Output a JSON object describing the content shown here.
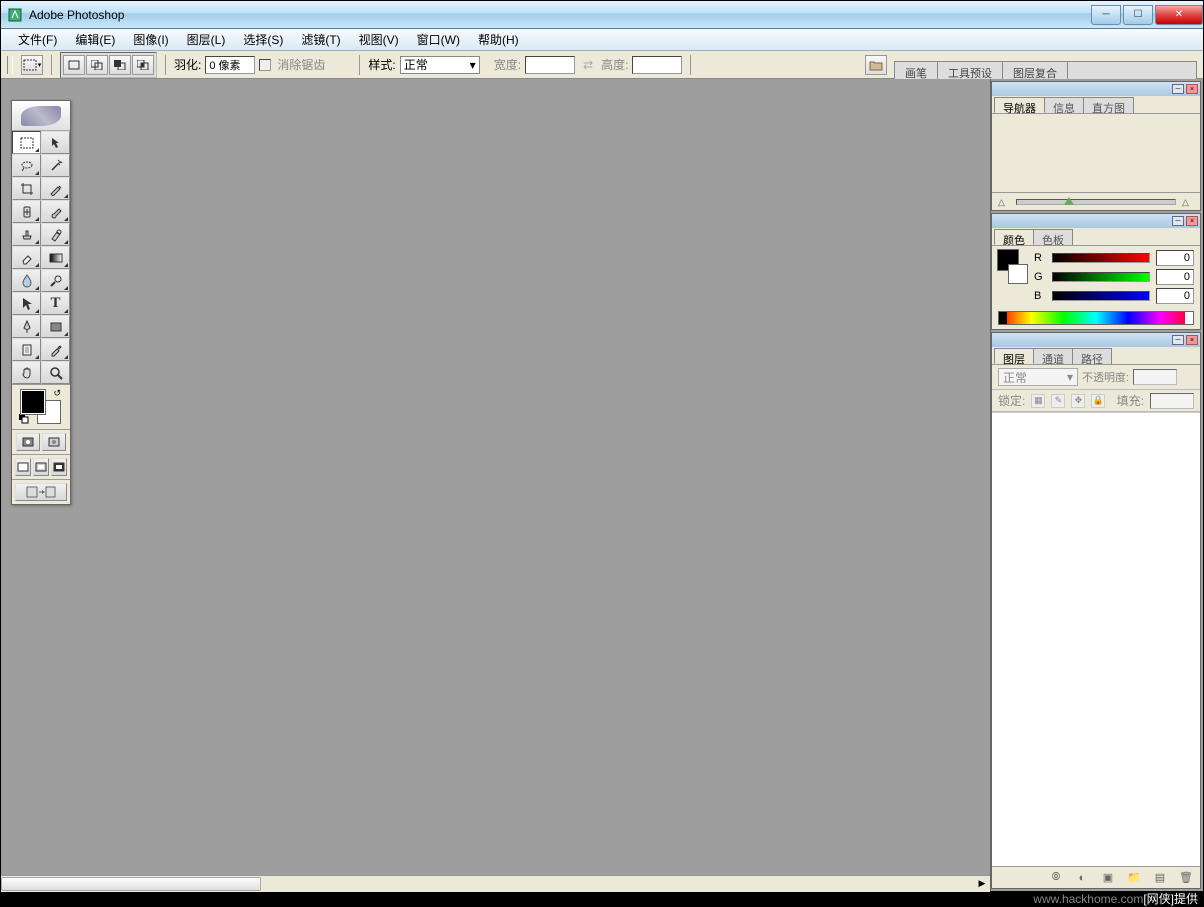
{
  "app": {
    "title": "Adobe Photoshop"
  },
  "menu": {
    "file": "文件(F)",
    "edit": "编辑(E)",
    "image": "图像(I)",
    "layer": "图层(L)",
    "select": "选择(S)",
    "filter": "滤镜(T)",
    "view": "视图(V)",
    "window": "窗口(W)",
    "help": "帮助(H)"
  },
  "options": {
    "feather_label": "羽化:",
    "feather_value": "0 像素",
    "antialias": "消除锯齿",
    "style_label": "样式:",
    "style_value": "正常",
    "width_label": "宽度:",
    "height_label": "高度:"
  },
  "palette_well": {
    "brush": "画笔",
    "tool_presets": "工具预设",
    "layer_comps": "图层复合"
  },
  "navigator_panel": {
    "tabs": {
      "navigator": "导航器",
      "info": "信息",
      "histogram": "直方图"
    }
  },
  "color_panel": {
    "tabs": {
      "color": "颜色",
      "swatches": "色板"
    },
    "r_label": "R",
    "g_label": "G",
    "b_label": "B",
    "r_value": "0",
    "g_value": "0",
    "b_value": "0"
  },
  "layers_panel": {
    "tabs": {
      "layers": "图层",
      "channels": "通道",
      "paths": "路径"
    },
    "blend_mode": "正常",
    "opacity_label": "不透明度:",
    "opacity_value": "",
    "lock_label": "锁定:",
    "fill_label": "填充:",
    "fill_value": ""
  },
  "watermark": {
    "prefix": "www.hackhome.com",
    "suffix": "[网侠]提供"
  }
}
